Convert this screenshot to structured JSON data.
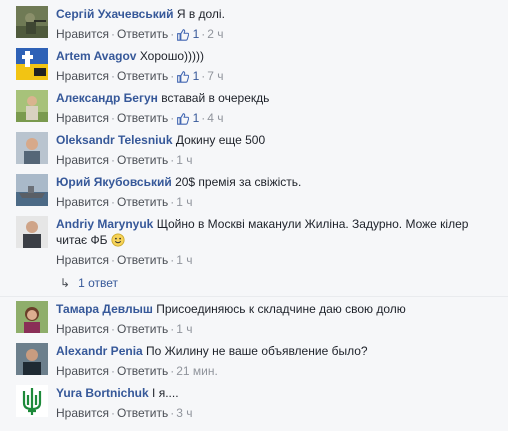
{
  "comments": [
    {
      "author": "Сергій Ухачевський",
      "text": "Я в долі.",
      "like": "Нравится",
      "reply": "Ответить",
      "likes": "1",
      "time": "2 ч",
      "avatar": "soldier-avatar"
    },
    {
      "author": "Artem Avagov",
      "text": "Хорошо)))))",
      "like": "Нравится",
      "reply": "Ответить",
      "likes": "1",
      "time": "7 ч",
      "avatar": "flag-avatar"
    },
    {
      "author": "Александр Бегун",
      "text": "вставай в очерекдь",
      "like": "Нравится",
      "reply": "Ответить",
      "likes": "1",
      "time": "4 ч",
      "avatar": "person-outdoor-avatar"
    },
    {
      "author": "Oleksandr Telesniuk",
      "text": "Докину еще 500",
      "like": "Нравится",
      "reply": "Ответить",
      "time": "1 ч",
      "avatar": "person-avatar"
    },
    {
      "author": "Юрий Якубовський",
      "text": "20$ премія за свіжість.",
      "like": "Нравится",
      "reply": "Ответить",
      "time": "1 ч",
      "avatar": "ship-avatar"
    },
    {
      "author": "Andriy Marynyuk",
      "text": "Щойно в Москві маканули Жиліна. Задурно. Може кілер",
      "text2": "читає ФБ",
      "like": "Нравится",
      "reply": "Ответить",
      "time": "1 ч",
      "avatar": "man-avatar"
    },
    {
      "author": "Тамара Девлыш",
      "text": "Присоединяюсь к складчине даю свою долю",
      "like": "Нравится",
      "reply": "Ответить",
      "time": "1 ч",
      "avatar": "woman-avatar"
    },
    {
      "author": "Alexandr Penia",
      "text": "По Жилину не ваше объявление было?",
      "like": "Нравится",
      "reply": "Ответить",
      "time": "21 мин.",
      "avatar": "man-dark-avatar"
    },
    {
      "author": "Yura Bortnichuk",
      "text": "І я....",
      "like": "Нравится",
      "reply": "Ответить",
      "time": "3 ч",
      "avatar": "trident-avatar"
    }
  ],
  "reply_thread": {
    "label": "1 ответ"
  },
  "colors": {
    "author": "#365899",
    "meta": "#90949c",
    "link": "#4b4f56",
    "background": "#f6f7f9"
  }
}
